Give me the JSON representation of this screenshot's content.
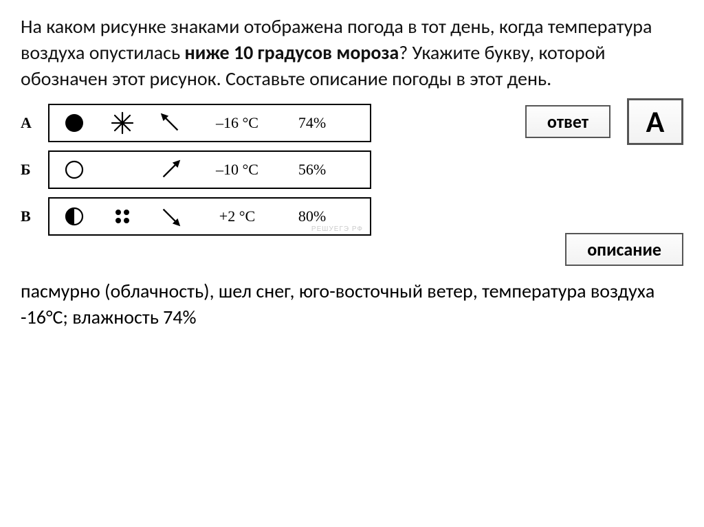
{
  "question": {
    "part1": "На каком рисунке знаками отображена погода в тот день, когда температура воздуха опустилась ",
    "bold": "ниже 10 градусов мороза",
    "part2": "? Укажите букву, которой обозначен этот рисунок. Составьте описание погоды в этот день."
  },
  "buttons": {
    "answer": "ответ",
    "description": "описание"
  },
  "answer_letter": "А",
  "options": [
    {
      "label": "А",
      "temp": "–16 °C",
      "humidity": "74%"
    },
    {
      "label": "Б",
      "temp": "–10 °C",
      "humidity": "56%"
    },
    {
      "label": "В",
      "temp": "+2 °C",
      "humidity": "80%"
    }
  ],
  "description": "пасмурно (облачность), шел снег, юго-восточный ветер, температура воздуха -16°С; влажность 74%",
  "watermark": "РЕШУЕГЭ РФ"
}
